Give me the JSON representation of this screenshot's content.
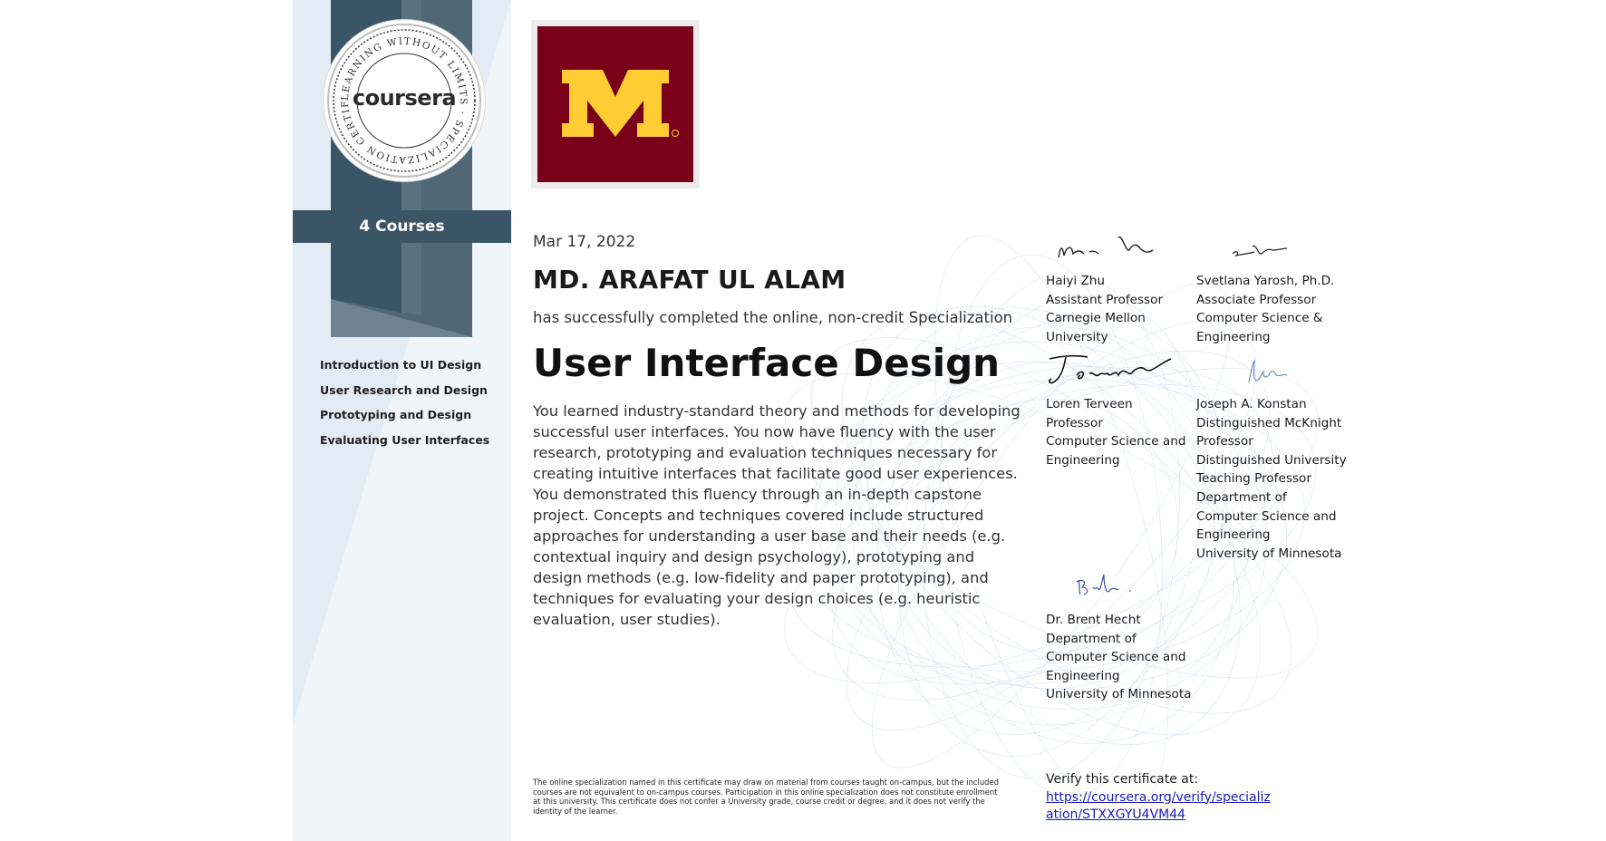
{
  "sidebar": {
    "seal_ring_text": "LEARNING WITHOUT LIMITS · SPECIALIZATION CERTIFICATE ·",
    "brand": "coursera",
    "courses_count_label": "4 Courses",
    "courses": [
      "Introduction to UI Design",
      "User Research and Design",
      "Prototyping and Design",
      "Evaluating User Interfaces"
    ]
  },
  "logo": {
    "icon": "university-of-minnesota-m-logo",
    "bg_color": "#7a0019",
    "fg_color": "#ffcc33"
  },
  "certificate": {
    "date": "Mar 17, 2022",
    "recipient": "MD. ARAFAT UL ALAM",
    "completion_text": "has successfully completed the online, non-credit Specialization",
    "title": "User Interface Design",
    "description": "You learned industry-standard theory and methods for developing successful user interfaces. You now have fluency with the user research, prototyping and evaluation techniques necessary for creating intuitive interfaces that facilitate good user experiences. You demonstrated this fluency through an in-depth capstone project. Concepts and techniques covered include structured approaches for understanding a user base and their needs (e.g. contextual inquiry and design psychology), prototyping and design methods (e.g. low-fidelity and paper prototyping), and techniques for evaluating your design choices (e.g. heuristic evaluation, user studies).",
    "disclaimer": "The online specialization named in this certificate may draw on material from courses taught on-campus, but the included courses are not equivalent to on-campus courses. Participation in this online specialization does not constitute enrollment at this university. This certificate does not confer a University grade, course credit or degree, and it does not verify the identity of the learner."
  },
  "signatories": [
    {
      "name": "Haiyi Zhu",
      "lines": [
        "Assistant Professor",
        "Carnegie Mellon",
        "University"
      ]
    },
    {
      "name": "Svetlana Yarosh, Ph.D.",
      "lines": [
        "Associate Professor",
        "Computer Science &",
        "Engineering"
      ]
    },
    {
      "name": "Loren Terveen",
      "lines": [
        "Professor",
        "Computer Science and",
        "Engineering"
      ]
    },
    {
      "name": "Joseph A. Konstan",
      "lines": [
        "Distinguished McKnight",
        "Professor",
        "Distinguished University",
        "Teaching Professor",
        "Department of",
        "Computer Science and",
        "Engineering",
        "University of Minnesota"
      ]
    },
    {
      "name": "Dr. Brent Hecht",
      "lines": [
        "Department of",
        "Computer Science and",
        "Engineering",
        "University of Minnesota"
      ]
    }
  ],
  "verify": {
    "label": "Verify this certificate at:",
    "url": "https://coursera.org/verify/specialization/STXXGYU4VM44"
  },
  "colors": {
    "sidebar_bg": "#e3ecf5",
    "ribbon_dark": "#3c5566",
    "ribbon_mid": "#5b7281",
    "link": "#1a1ab8"
  }
}
